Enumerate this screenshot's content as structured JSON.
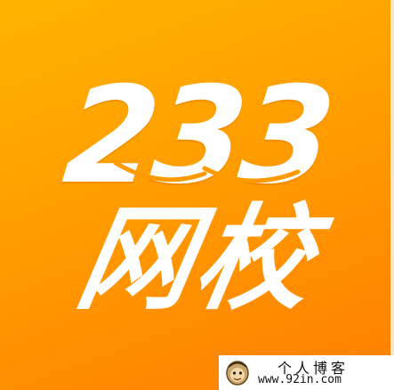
{
  "logo": {
    "number_text": "233",
    "chinese_text": "网校",
    "background_color": "#ff9a00",
    "text_color": "#ffffff"
  },
  "watermark": {
    "title": "个人博客",
    "url": "www.92in.com",
    "avatar_icon": "cartoon-avatar-icon"
  }
}
